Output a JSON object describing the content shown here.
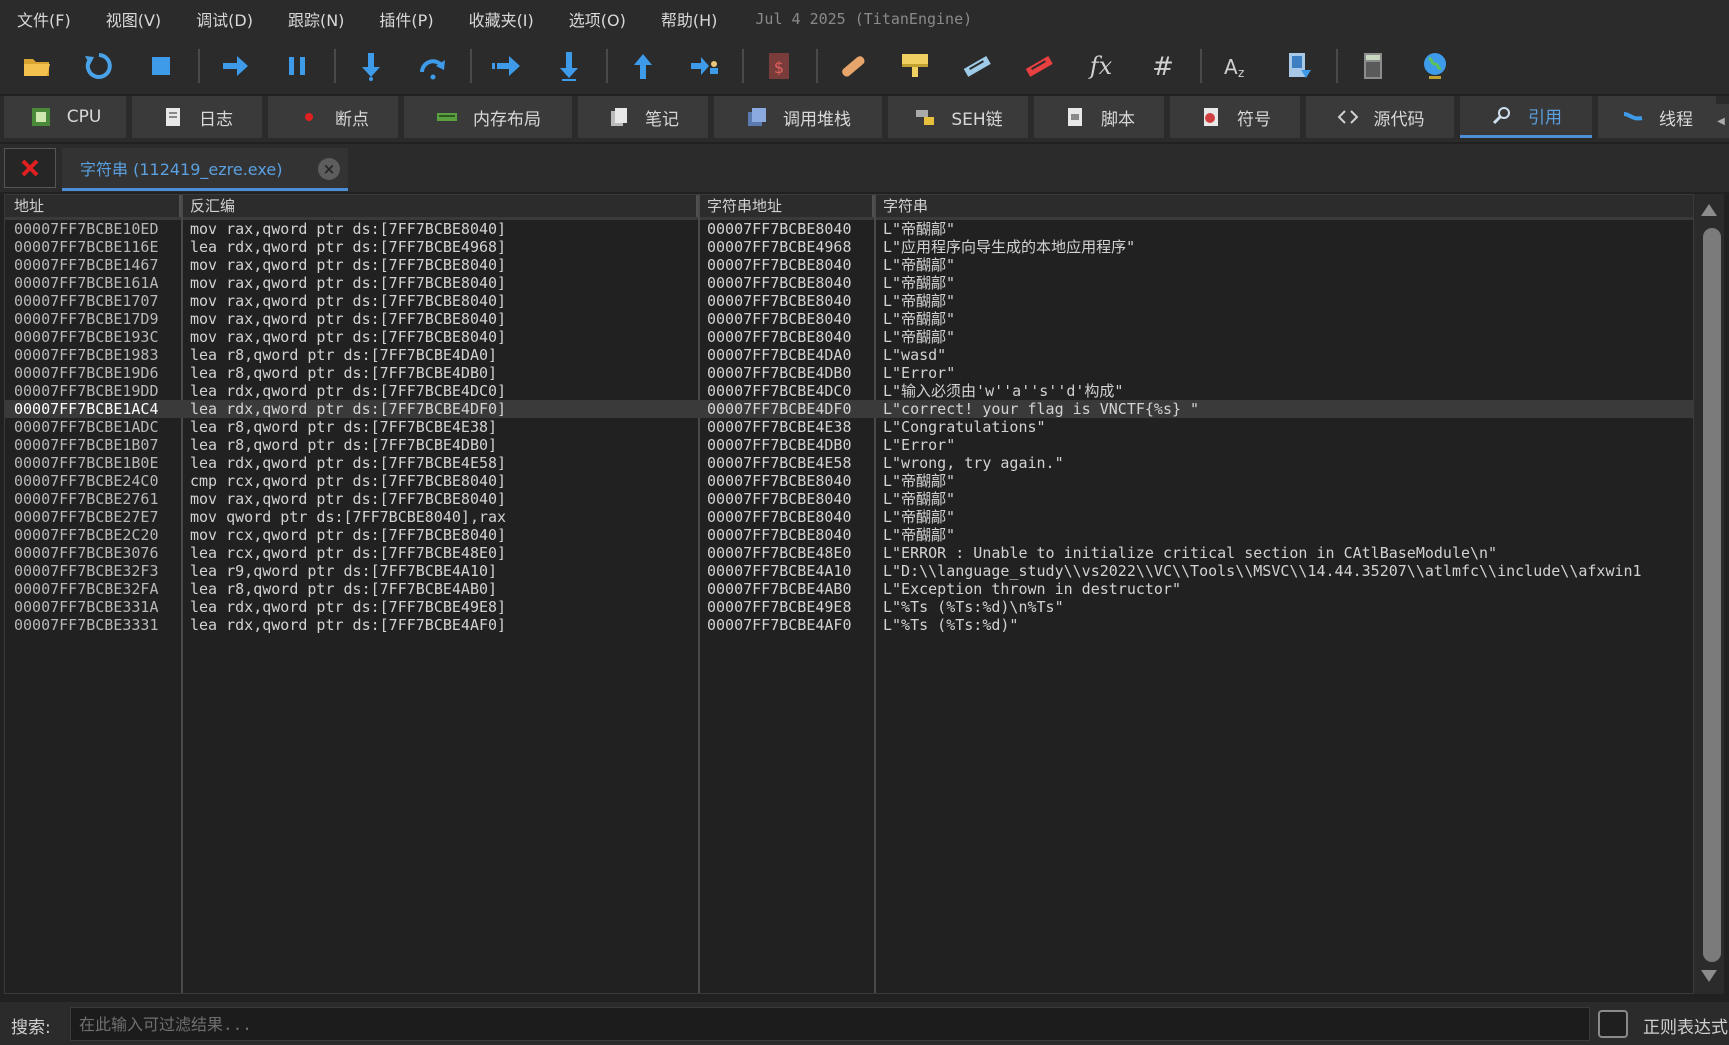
{
  "menu": {
    "items": [
      "文件(F)",
      "视图(V)",
      "调试(D)",
      "跟踪(N)",
      "插件(P)",
      "收藏夹(I)",
      "选项(O)",
      "帮助(H)"
    ],
    "build_info": "Jul 4 2025 (TitanEngine)"
  },
  "toolbar": {
    "icons": [
      "open-icon",
      "restart-icon",
      "stop-icon",
      "run-icon",
      "pause-icon",
      "step-into-icon",
      "step-over-icon",
      "trace-into-icon",
      "trace-over-icon",
      "run-to-user-code-icon",
      "step-out-icon",
      "script-icon",
      "patch-icon",
      "comment-icon",
      "label-icon",
      "bookmark-icon",
      "function-icon",
      "hash-icon",
      "font-icon",
      "memory-icon",
      "calculator-icon",
      "globe-icon"
    ]
  },
  "tabs": [
    {
      "label": "CPU",
      "icon": "cpu-icon"
    },
    {
      "label": "日志",
      "icon": "log-icon"
    },
    {
      "label": "断点",
      "icon": "breakpoint-icon"
    },
    {
      "label": "内存布局",
      "icon": "memory-map-icon"
    },
    {
      "label": "笔记",
      "icon": "notes-icon"
    },
    {
      "label": "调用堆栈",
      "icon": "call-stack-icon"
    },
    {
      "label": "SEH链",
      "icon": "seh-icon"
    },
    {
      "label": "脚本",
      "icon": "script-icon"
    },
    {
      "label": "符号",
      "icon": "symbol-icon"
    },
    {
      "label": "源代码",
      "icon": "source-icon"
    },
    {
      "label": "引用",
      "icon": "references-icon",
      "active": true
    },
    {
      "label": "线程",
      "icon": "threads-icon"
    }
  ],
  "doc_tab": {
    "label": "字符串 (112419_ezre.exe)"
  },
  "table": {
    "headers": [
      "地址",
      "反汇编",
      "字符串地址",
      "字符串"
    ],
    "selected_index": 10,
    "rows": [
      [
        "00007FF7BCBE10ED",
        "mov rax,qword ptr ds:[7FF7BCBE8040]",
        "00007FF7BCBE8040",
        "L\"帝醐鄗\""
      ],
      [
        "00007FF7BCBE116E",
        "lea rdx,qword ptr ds:[7FF7BCBE4968]",
        "00007FF7BCBE4968",
        "L\"应用程序向导生成的本地应用程序\""
      ],
      [
        "00007FF7BCBE1467",
        "mov rax,qword ptr ds:[7FF7BCBE8040]",
        "00007FF7BCBE8040",
        "L\"帝醐鄗\""
      ],
      [
        "00007FF7BCBE161A",
        "mov rax,qword ptr ds:[7FF7BCBE8040]",
        "00007FF7BCBE8040",
        "L\"帝醐鄗\""
      ],
      [
        "00007FF7BCBE1707",
        "mov rax,qword ptr ds:[7FF7BCBE8040]",
        "00007FF7BCBE8040",
        "L\"帝醐鄗\""
      ],
      [
        "00007FF7BCBE17D9",
        "mov rax,qword ptr ds:[7FF7BCBE8040]",
        "00007FF7BCBE8040",
        "L\"帝醐鄗\""
      ],
      [
        "00007FF7BCBE193C",
        "mov rax,qword ptr ds:[7FF7BCBE8040]",
        "00007FF7BCBE8040",
        "L\"帝醐鄗\""
      ],
      [
        "00007FF7BCBE1983",
        "lea r8,qword ptr ds:[7FF7BCBE4DA0]",
        "00007FF7BCBE4DA0",
        "L\"wasd\""
      ],
      [
        "00007FF7BCBE19D6",
        "lea r8,qword ptr ds:[7FF7BCBE4DB0]",
        "00007FF7BCBE4DB0",
        "L\"Error\""
      ],
      [
        "00007FF7BCBE19DD",
        "lea rdx,qword ptr ds:[7FF7BCBE4DC0]",
        "00007FF7BCBE4DC0",
        "L\"输入必须由'w''a''s''d'构成\""
      ],
      [
        "00007FF7BCBE1AC4",
        "lea rdx,qword ptr ds:[7FF7BCBE4DF0]",
        "00007FF7BCBE4DF0",
        "L\"correct! your flag is VNCTF{%s} \""
      ],
      [
        "00007FF7BCBE1ADC",
        "lea r8,qword ptr ds:[7FF7BCBE4E38]",
        "00007FF7BCBE4E38",
        "L\"Congratulations\""
      ],
      [
        "00007FF7BCBE1B07",
        "lea r8,qword ptr ds:[7FF7BCBE4DB0]",
        "00007FF7BCBE4DB0",
        "L\"Error\""
      ],
      [
        "00007FF7BCBE1B0E",
        "lea rdx,qword ptr ds:[7FF7BCBE4E58]",
        "00007FF7BCBE4E58",
        "L\"wrong, try again.\""
      ],
      [
        "00007FF7BCBE24C0",
        "cmp rcx,qword ptr ds:[7FF7BCBE8040]",
        "00007FF7BCBE8040",
        "L\"帝醐鄗\""
      ],
      [
        "00007FF7BCBE2761",
        "mov rax,qword ptr ds:[7FF7BCBE8040]",
        "00007FF7BCBE8040",
        "L\"帝醐鄗\""
      ],
      [
        "00007FF7BCBE27E7",
        "mov qword ptr ds:[7FF7BCBE8040],rax",
        "00007FF7BCBE8040",
        "L\"帝醐鄗\""
      ],
      [
        "00007FF7BCBE2C20",
        "mov rcx,qword ptr ds:[7FF7BCBE8040]",
        "00007FF7BCBE8040",
        "L\"帝醐鄗\""
      ],
      [
        "00007FF7BCBE3076",
        "lea rcx,qword ptr ds:[7FF7BCBE48E0]",
        "00007FF7BCBE48E0",
        "L\"ERROR : Unable to initialize critical section in CAtlBaseModule\\n\""
      ],
      [
        "00007FF7BCBE32F3",
        "lea r9,qword ptr ds:[7FF7BCBE4A10]",
        "00007FF7BCBE4A10",
        "L\"D:\\\\language_study\\\\vs2022\\\\VC\\\\Tools\\\\MSVC\\\\14.44.35207\\\\atlmfc\\\\include\\\\afxwin1"
      ],
      [
        "00007FF7BCBE32FA",
        "lea r8,qword ptr ds:[7FF7BCBE4AB0]",
        "00007FF7BCBE4AB0",
        "L\"Exception thrown in destructor\""
      ],
      [
        "00007FF7BCBE331A",
        "lea rdx,qword ptr ds:[7FF7BCBE49E8]",
        "00007FF7BCBE49E8",
        "L\"%Ts (%Ts:%d)\\n%Ts\""
      ],
      [
        "00007FF7BCBE3331",
        "lea rdx,qword ptr ds:[7FF7BCBE4AF0]",
        "00007FF7BCBE4AF0",
        "L\"%Ts (%Ts:%d)\""
      ]
    ]
  },
  "search": {
    "label": "搜索:",
    "value": "",
    "placeholder": "在此输入可过滤结果...",
    "regex_label": "正则表达式"
  },
  "colors": {
    "accent": "#4b8fd6",
    "background": "#212121",
    "panel": "#2b2b2b"
  }
}
